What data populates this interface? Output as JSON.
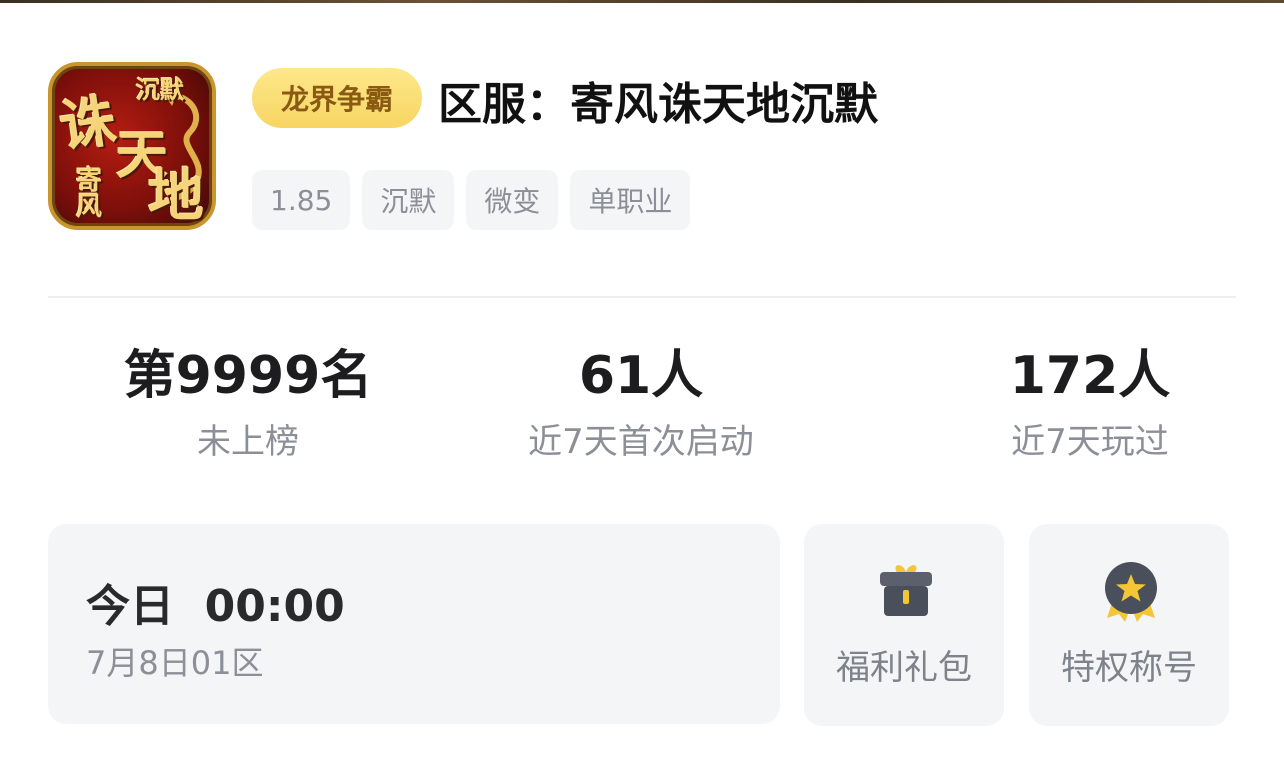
{
  "header": {
    "icon_text": {
      "top": "沉默",
      "big1": "诛",
      "big2": "天",
      "big3": "地",
      "side": "寄风"
    },
    "server_tag": "龙界争霸",
    "server_title": "区服：寄风诛天地沉默",
    "tags": [
      "1.85",
      "沉默",
      "微变",
      "单职业"
    ]
  },
  "stats": [
    {
      "value": "第9999名",
      "label": "未上榜"
    },
    {
      "value": "61人",
      "label": "近7天首次启动"
    },
    {
      "value": "172人",
      "label": "近7天玩过"
    }
  ],
  "open_server": {
    "time": "今日  00:00",
    "subtitle": "7月8日01区"
  },
  "actions": {
    "gift": {
      "label": "福利礼包",
      "icon": "gift-icon"
    },
    "title": {
      "label": "特权称号",
      "icon": "medal-star-icon"
    }
  },
  "colors": {
    "tag_bg": "#f4f5f7",
    "server_tag_bg": "#f7d563",
    "server_tag_text": "#8a5a12",
    "muted_text": "#8b8f97",
    "accent_gold": "#f4c534",
    "icon_dark": "#4a4f5c"
  }
}
